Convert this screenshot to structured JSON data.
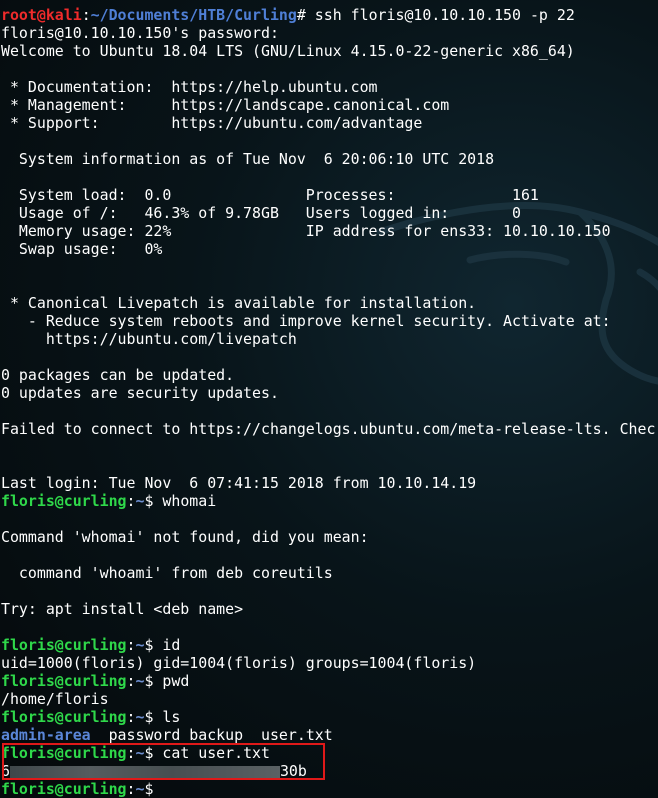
{
  "terminal": {
    "lines": [
      {
        "type": "root_prompt",
        "user": "root@kali",
        "sep": ":",
        "path": "~/Documents/HTB/Curling",
        "symbol": "# ",
        "cmd": "ssh floris@10.10.10.150 -p 22"
      },
      {
        "type": "text",
        "text": "floris@10.10.10.150's password:"
      },
      {
        "type": "text",
        "text": "Welcome to Ubuntu 18.04 LTS (GNU/Linux 4.15.0-22-generic x86_64)"
      },
      {
        "type": "text",
        "text": ""
      },
      {
        "type": "text",
        "text": " * Documentation:  https://help.ubuntu.com"
      },
      {
        "type": "text",
        "text": " * Management:     https://landscape.canonical.com"
      },
      {
        "type": "text",
        "text": " * Support:        https://ubuntu.com/advantage"
      },
      {
        "type": "text",
        "text": ""
      },
      {
        "type": "text",
        "text": "  System information as of Tue Nov  6 20:06:10 UTC 2018"
      },
      {
        "type": "text",
        "text": ""
      },
      {
        "type": "text",
        "text": "  System load:  0.0               Processes:             161"
      },
      {
        "type": "text",
        "text": "  Usage of /:   46.3% of 9.78GB   Users logged in:       0"
      },
      {
        "type": "text",
        "text": "  Memory usage: 22%               IP address for ens33: 10.10.10.150"
      },
      {
        "type": "text",
        "text": "  Swap usage:   0%"
      },
      {
        "type": "text",
        "text": ""
      },
      {
        "type": "text",
        "text": ""
      },
      {
        "type": "text",
        "text": " * Canonical Livepatch is available for installation."
      },
      {
        "type": "text",
        "text": "   - Reduce system reboots and improve kernel security. Activate at:"
      },
      {
        "type": "text",
        "text": "     https://ubuntu.com/livepatch"
      },
      {
        "type": "text",
        "text": ""
      },
      {
        "type": "text",
        "text": "0 packages can be updated."
      },
      {
        "type": "text",
        "text": "0 updates are security updates."
      },
      {
        "type": "text",
        "text": ""
      },
      {
        "type": "text",
        "text": "Failed to connect to https://changelogs.ubuntu.com/meta-release-lts. Chec"
      },
      {
        "type": "text",
        "text": ""
      },
      {
        "type": "text",
        "text": ""
      },
      {
        "type": "text",
        "text": "Last login: Tue Nov  6 07:41:15 2018 from 10.10.14.19"
      },
      {
        "type": "prompt",
        "user": "floris@curling",
        "sep": ":",
        "path": "~",
        "symbol": "$ ",
        "cmd": "whomai"
      },
      {
        "type": "text",
        "text": ""
      },
      {
        "type": "text",
        "text": "Command 'whomai' not found, did you mean:"
      },
      {
        "type": "text",
        "text": ""
      },
      {
        "type": "text",
        "text": "  command 'whoami' from deb coreutils"
      },
      {
        "type": "text",
        "text": ""
      },
      {
        "type": "text",
        "text": "Try: apt install <deb name>"
      },
      {
        "type": "text",
        "text": ""
      },
      {
        "type": "prompt",
        "user": "floris@curling",
        "sep": ":",
        "path": "~",
        "symbol": "$ ",
        "cmd": "id"
      },
      {
        "type": "text",
        "text": "uid=1000(floris) gid=1004(floris) groups=1004(floris)"
      },
      {
        "type": "prompt",
        "user": "floris@curling",
        "sep": ":",
        "path": "~",
        "symbol": "$ ",
        "cmd": "pwd"
      },
      {
        "type": "text",
        "text": "/home/floris"
      },
      {
        "type": "prompt",
        "user": "floris@curling",
        "sep": ":",
        "path": "~",
        "symbol": "$ ",
        "cmd": "ls"
      },
      {
        "type": "ls",
        "dir": "admin-area",
        "rest": "  password_backup  user.txt"
      },
      {
        "type": "prompt",
        "user": "floris@curling",
        "sep": ":",
        "path": "~",
        "symbol": "$ ",
        "cmd": "cat user.txt"
      },
      {
        "type": "flag",
        "prefix": "6",
        "suffix": "30b"
      },
      {
        "type": "prompt",
        "user": "floris@curling",
        "sep": ":",
        "path": "~",
        "symbol": "$ ",
        "cmd": ""
      }
    ]
  },
  "colors": {
    "root_user": "#ef2b2b",
    "user_prompt": "#2fd84a",
    "path": "#4f7fd6",
    "directory": "#5a86d8",
    "highlight_box": "#e01919",
    "text": "#ffffff",
    "background": "#081419"
  },
  "icons": {
    "background_logo": "kali-dragon-icon"
  }
}
